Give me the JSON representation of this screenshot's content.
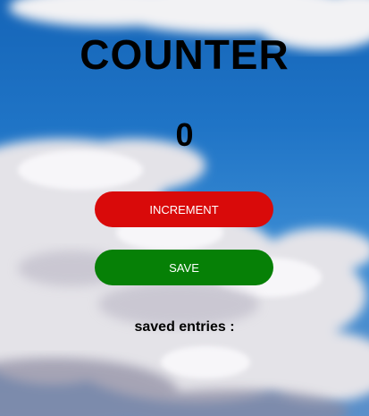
{
  "app": {
    "title": "COUNTER",
    "count": "0"
  },
  "buttons": {
    "increment_label": "INCREMENT",
    "save_label": "SAVE"
  },
  "saved": {
    "label": "saved entries :"
  },
  "colors": {
    "increment_bg": "#d90a0a",
    "save_bg": "#068006",
    "sky": "#1f74c6"
  },
  "background": {
    "image": "sky-with-clouds"
  }
}
